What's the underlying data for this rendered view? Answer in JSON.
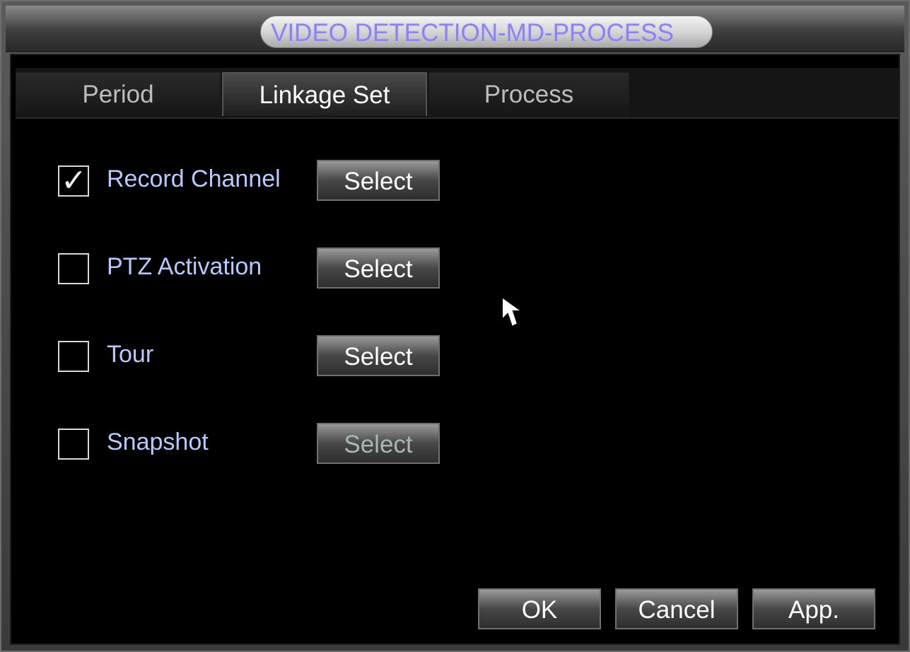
{
  "window": {
    "title": "VIDEO DETECTION-MD-PROCESS"
  },
  "tabs": [
    {
      "label": "Period",
      "active": false
    },
    {
      "label": "Linkage Set",
      "active": true
    },
    {
      "label": "Process",
      "active": false
    }
  ],
  "linkage": {
    "items": [
      {
        "label": "Record Channel",
        "checked": true,
        "button_label": "Select",
        "button_enabled": true
      },
      {
        "label": "PTZ Activation",
        "checked": false,
        "button_label": "Select",
        "button_enabled": true
      },
      {
        "label": "Tour",
        "checked": false,
        "button_label": "Select",
        "button_enabled": true
      },
      {
        "label": "Snapshot",
        "checked": false,
        "button_label": "Select",
        "button_enabled": false
      }
    ]
  },
  "footer": {
    "ok_label": "OK",
    "cancel_label": "Cancel",
    "apply_label": "App."
  },
  "icons": {
    "checkmark": "checkmark-icon",
    "cursor": "mouse-pointer-icon"
  },
  "colors": {
    "title_text": "#8b83ee",
    "label_text": "#b9c9ff",
    "background": "#000000"
  }
}
